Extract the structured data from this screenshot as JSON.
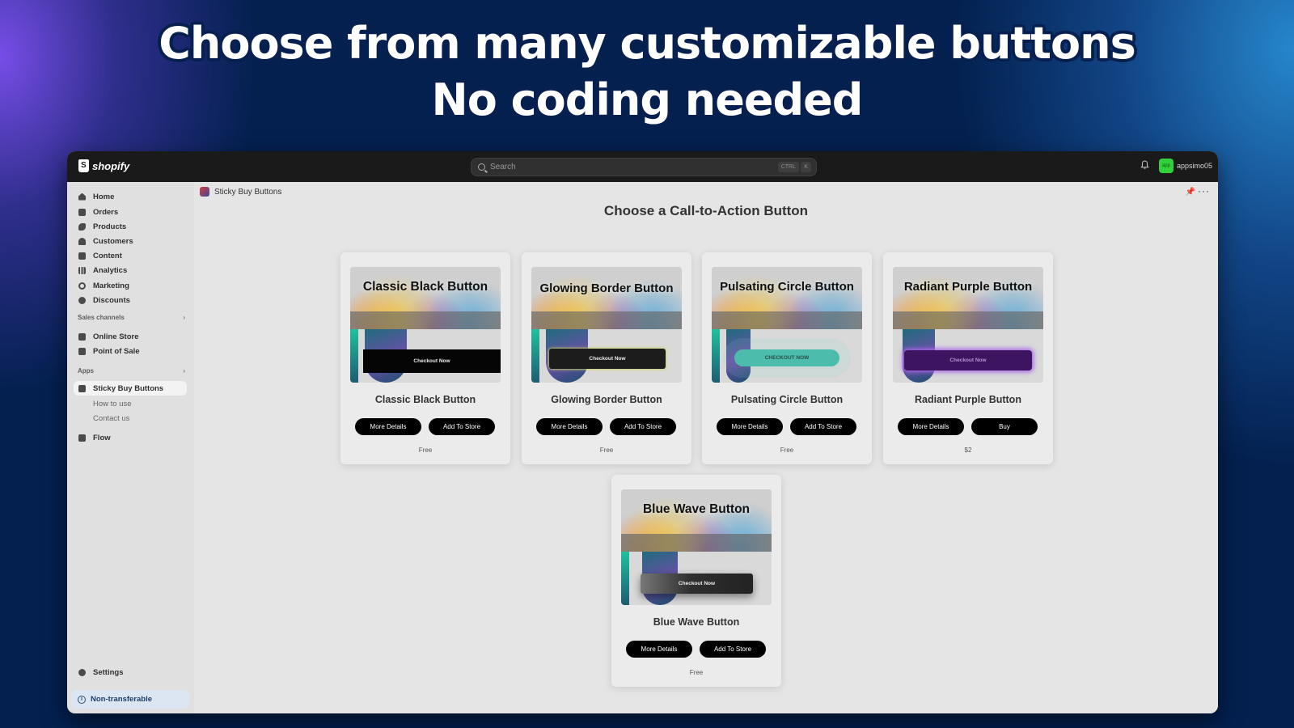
{
  "headline": {
    "line1": "Choose from many customizable buttons",
    "line2": "No coding needed"
  },
  "topbar": {
    "brand": "shopify",
    "search_placeholder": "Search",
    "shortcut_ctrl": "CTRL",
    "shortcut_key": "K",
    "avatar_label": "app",
    "username": "appsimo05",
    "accent_color": "#30d13b"
  },
  "sidebar": {
    "items": [
      {
        "label": "Home",
        "icon": "home-icon"
      },
      {
        "label": "Orders",
        "icon": "inbox-icon"
      },
      {
        "label": "Products",
        "icon": "tag-icon"
      },
      {
        "label": "Customers",
        "icon": "person-icon"
      },
      {
        "label": "Content",
        "icon": "image-icon"
      },
      {
        "label": "Analytics",
        "icon": "bar-chart-icon"
      },
      {
        "label": "Marketing",
        "icon": "target-icon"
      },
      {
        "label": "Discounts",
        "icon": "discount-icon"
      }
    ],
    "sales_channels_heading": "Sales channels",
    "sales_channels": [
      {
        "label": "Online Store",
        "icon": "store-icon"
      },
      {
        "label": "Point of Sale",
        "icon": "pos-icon"
      }
    ],
    "apps_heading": "Apps",
    "apps": [
      {
        "label": "Sticky Buy Buttons",
        "icon": "app-icon",
        "active": true
      },
      {
        "label": "How to use"
      },
      {
        "label": "Contact us"
      },
      {
        "label": "Flow",
        "icon": "flow-icon"
      }
    ],
    "settings_label": "Settings",
    "non_transferable_label": "Non-transferable"
  },
  "main": {
    "breadcrumb": "Sticky Buy Buttons",
    "page_title": "Choose a Call-to-Action Button",
    "cards": [
      {
        "preview_title": "Classic Black Button",
        "preview_cta": "Checkout Now",
        "name": "Classic Black Button",
        "left_button": "More Details",
        "right_button": "Add To Store",
        "price": "Free"
      },
      {
        "preview_title": "Glowing Border Button",
        "preview_cta": "Checkout Now",
        "name": "Glowing Border Button",
        "left_button": "More Details",
        "right_button": "Add To Store",
        "price": "Free"
      },
      {
        "preview_title": "Pulsating Circle Button",
        "preview_cta": "CHECKOUT NOW",
        "name": "Pulsating Circle Button",
        "left_button": "More Details",
        "right_button": "Add To Store",
        "price": "Free"
      },
      {
        "preview_title": "Radiant Purple Button",
        "preview_cta": "Checkout Now",
        "name": "Radiant Purple Button",
        "left_button": "More Details",
        "right_button": "Buy",
        "price": "$2"
      },
      {
        "preview_title": "Blue Wave Button",
        "preview_cta": "Checkout Now",
        "name": "Blue Wave Button",
        "left_button": "More Details",
        "right_button": "Add To Store",
        "price": "Free"
      }
    ]
  }
}
